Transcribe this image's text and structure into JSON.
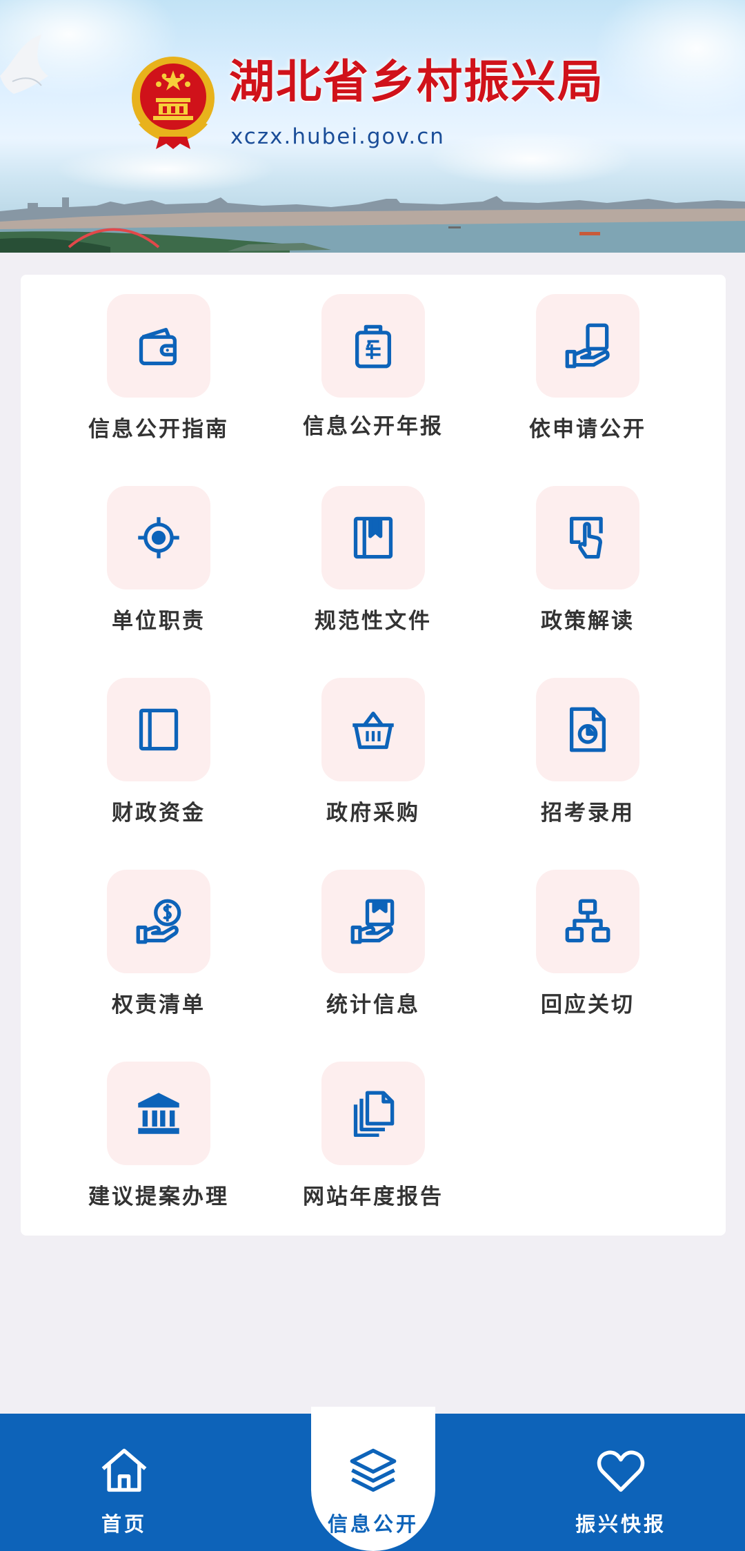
{
  "banner": {
    "title": "湖北省乡村振兴局",
    "url": "xczx.hubei.gov.cn"
  },
  "grid": [
    {
      "label": "信息公开指南",
      "icon": "wallet-icon"
    },
    {
      "label": "信息公开年报",
      "icon": "clipboard-year-icon"
    },
    {
      "label": "依申请公开",
      "icon": "hand-document-icon"
    },
    {
      "label": "单位职责",
      "icon": "target-icon"
    },
    {
      "label": "规范性文件",
      "icon": "bookmark-book-icon"
    },
    {
      "label": "政策解读",
      "icon": "touch-document-icon"
    },
    {
      "label": "财政资金",
      "icon": "ledger-icon"
    },
    {
      "label": "政府采购",
      "icon": "basket-icon"
    },
    {
      "label": "招考录用",
      "icon": "chart-document-icon"
    },
    {
      "label": "权责清单",
      "icon": "hand-coin-icon"
    },
    {
      "label": "统计信息",
      "icon": "hand-box-icon"
    },
    {
      "label": "回应关切",
      "icon": "org-chart-icon"
    },
    {
      "label": "建议提案办理",
      "icon": "institution-icon"
    },
    {
      "label": "网站年度报告",
      "icon": "copy-documents-icon"
    }
  ],
  "nav": {
    "items": [
      {
        "label": "首页",
        "icon": "home-icon"
      },
      {
        "label": "信息公开",
        "icon": "layers-icon"
      },
      {
        "label": "振兴快报",
        "icon": "heart-icon"
      }
    ],
    "active": "信息公开"
  },
  "colors": {
    "accent": "#0d63b9",
    "icon_bg": "#fdeeee",
    "title_red": "#d0121a",
    "page_bg": "#f1eff4"
  }
}
